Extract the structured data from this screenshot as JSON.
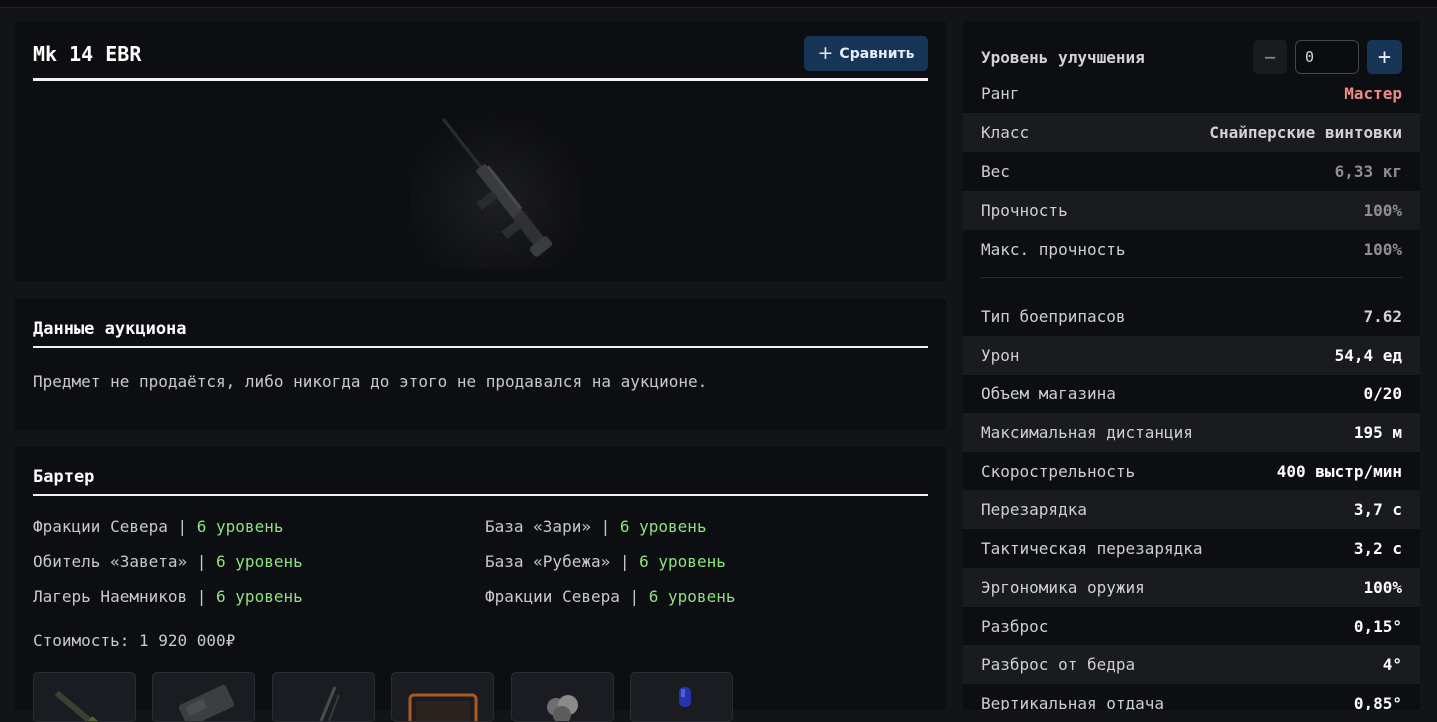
{
  "item": {
    "title": "Mk 14 EBR",
    "compare_label": "Сравнить",
    "image_icon": "rifle-image"
  },
  "auction": {
    "title": "Данные аукциона",
    "text": "Предмет не продаётся, либо никогда до этого не продавался на аукционе."
  },
  "barter": {
    "title": "Бартер",
    "entries": [
      {
        "name": "Фракции Севера",
        "level": "6 уровень"
      },
      {
        "name": "База «Зари»",
        "level": "6 уровень"
      },
      {
        "name": "Обитель «Завета»",
        "level": "6 уровень"
      },
      {
        "name": "База «Рубежа»",
        "level": "6 уровень"
      },
      {
        "name": "Лагерь Наемников",
        "level": "6 уровень"
      },
      {
        "name": "Фракции Севера",
        "level": "6 уровень"
      }
    ],
    "cost": "Стоимость: 1 920 000₽",
    "ingredient_icons": [
      "rifle-part-icon",
      "device-icon",
      "antenna-icon",
      "orange-case-icon",
      "ore-icon",
      "blue-vial-icon"
    ]
  },
  "stats": {
    "upgrade_label": "Уровень улучшения",
    "upgrade_value": "0",
    "rows": [
      {
        "k": "Ранг",
        "v": "Мастер"
      },
      {
        "k": "Класс",
        "v": "Снайперские винтовки"
      },
      {
        "k": "Вес",
        "v": "6,33 кг"
      },
      {
        "k": "Прочность",
        "v": "100%"
      },
      {
        "k": "Макс. прочность",
        "v": "100%"
      },
      {
        "k": "Тип боеприпасов",
        "v": "7.62"
      },
      {
        "k": "Урон",
        "v": "54,4 ед"
      },
      {
        "k": "Объем магазина",
        "v": "0/20"
      },
      {
        "k": "Максимальная дистанция",
        "v": "195 м"
      },
      {
        "k": "Скорострельность",
        "v": "400 выстр/мин"
      },
      {
        "k": "Перезарядка",
        "v": "3,7 с"
      },
      {
        "k": "Тактическая перезарядка",
        "v": "3,2 с"
      },
      {
        "k": "Эргономика оружия",
        "v": "100%"
      },
      {
        "k": "Разброс",
        "v": "0,15°"
      },
      {
        "k": "Разброс от бедра",
        "v": "4°"
      },
      {
        "k": "Вертикальная отдача",
        "v": "0,85°"
      }
    ],
    "colors": {
      "rank": "#ef8a86",
      "level": "#8ee27e",
      "accent": "#173556"
    }
  }
}
